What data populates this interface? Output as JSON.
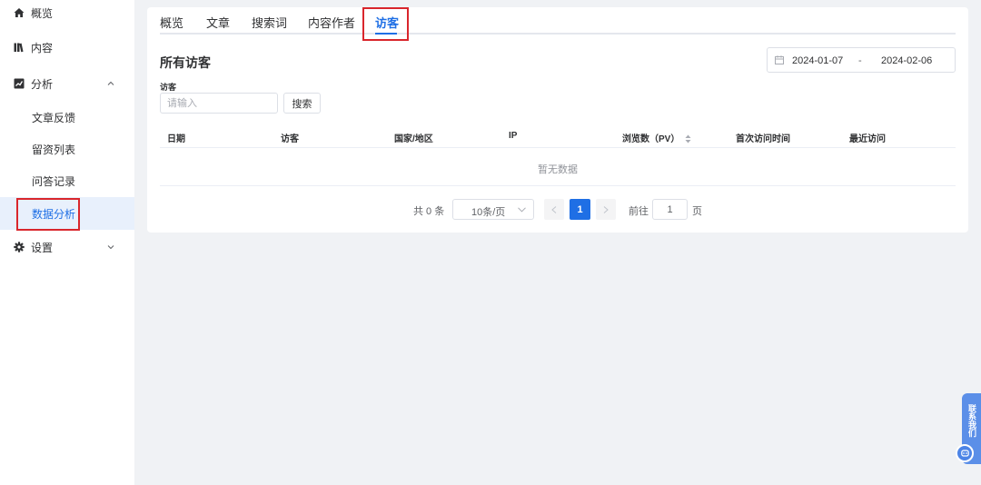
{
  "sidebar": {
    "items": [
      {
        "label": "概览",
        "icon": "home-icon"
      },
      {
        "label": "内容",
        "icon": "books-icon"
      },
      {
        "label": "分析",
        "icon": "chart-icon",
        "expanded": true,
        "children": [
          {
            "label": "文章反馈"
          },
          {
            "label": "留资列表"
          },
          {
            "label": "问答记录"
          },
          {
            "label": "数据分析",
            "active": true
          }
        ]
      },
      {
        "label": "设置",
        "icon": "gear-icon",
        "expanded": false
      }
    ]
  },
  "tabs": [
    {
      "label": "概览"
    },
    {
      "label": "文章"
    },
    {
      "label": "搜索词"
    },
    {
      "label": "内容作者"
    },
    {
      "label": "访客",
      "active": true
    }
  ],
  "main": {
    "title": "所有访客",
    "date_start": "2024-01-07",
    "date_sep": "-",
    "date_end": "2024-02-06",
    "filter_label": "访客",
    "search_placeholder": "请输入",
    "search_value": "",
    "search_button": "搜索"
  },
  "table": {
    "columns": [
      "日期",
      "访客",
      "国家/地区",
      "IP",
      "浏览数（PV）",
      "首次访问时间",
      "最近访问"
    ],
    "rows": [],
    "empty_text": "暂无数据"
  },
  "pagination": {
    "total": "共 0 条",
    "page_size": "10条/页",
    "current_page": "1",
    "goto_label": "前往",
    "goto_value": "1",
    "page_suffix": "页"
  },
  "float_widget": {
    "label": "联系我们"
  },
  "colors": {
    "accent": "#1f6fe5",
    "highlight": "#d9262c",
    "background": "#f0f2f5"
  }
}
